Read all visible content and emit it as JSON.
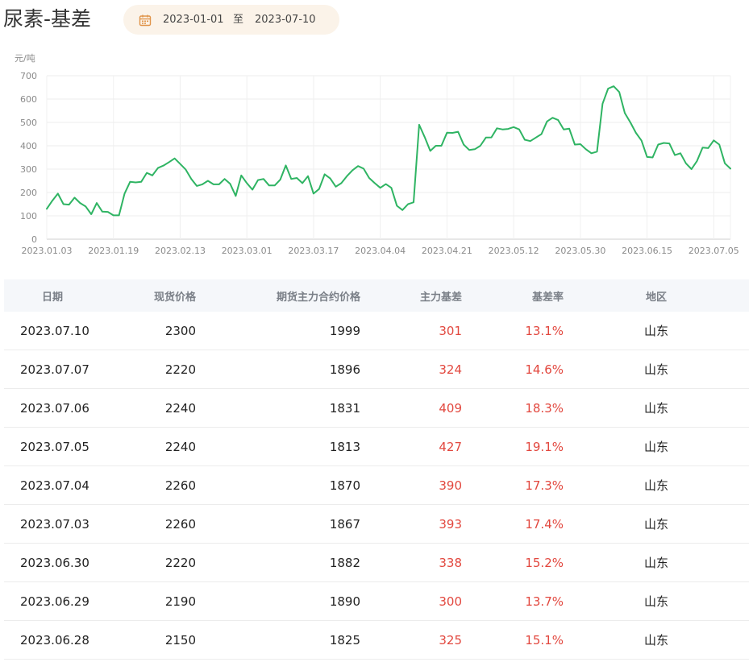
{
  "page": {
    "title": "尿素-基差"
  },
  "date_filter": {
    "start": "2023-01-01",
    "separator": "至",
    "end": "2023-07-10"
  },
  "colors": {
    "line": "#2fb463",
    "accent_red": "#e2473e",
    "header_bg": "#f5f7fa",
    "filter_bg": "#fbf3e9"
  },
  "chart_data": {
    "type": "line",
    "unit_label": "元/吨",
    "ylim": [
      0,
      700
    ],
    "yticks": [
      0,
      100,
      200,
      300,
      400,
      500,
      600,
      700
    ],
    "grid": true,
    "xtick_labels": [
      "2023.01.03",
      "2023.01.19",
      "2023.02.13",
      "2023.03.01",
      "2023.03.17",
      "2023.04.04",
      "2023.04.21",
      "2023.05.12",
      "2023.05.30",
      "2023.06.15",
      "2023.07.05"
    ],
    "xtick_index": [
      0,
      12,
      24,
      36,
      48,
      60,
      72,
      84,
      96,
      108,
      120
    ],
    "series": [
      {
        "values": [
          130,
          165,
          195,
          150,
          148,
          178,
          155,
          140,
          107,
          155,
          118,
          117,
          102,
          102,
          195,
          246,
          243,
          246,
          284,
          273,
          305,
          315,
          330,
          346,
          322,
          298,
          258,
          228,
          235,
          250,
          235,
          235,
          258,
          237,
          185,
          273,
          240,
          212,
          253,
          258,
          230,
          230,
          255,
          316,
          258,
          262,
          240,
          270,
          195,
          215,
          278,
          260,
          225,
          240,
          270,
          295,
          313,
          302,
          262,
          240,
          220,
          236,
          220,
          143,
          125,
          150,
          158,
          490,
          437,
          378,
          400,
          400,
          456,
          455,
          460,
          405,
          382,
          385,
          400,
          435,
          436,
          475,
          470,
          472,
          480,
          470,
          426,
          420,
          435,
          450,
          504,
          520,
          510,
          470,
          473,
          405,
          407,
          385,
          368,
          375,
          580,
          645,
          655,
          630,
          540,
          500,
          455,
          422,
          352,
          350,
          405,
          412,
          410,
          360,
          368,
          325,
          300,
          335,
          392,
          390,
          423,
          405,
          325,
          302
        ]
      }
    ]
  },
  "table": {
    "headers": [
      "日期",
      "现货价格",
      "期货主力合约价格",
      "主力基差",
      "基差率",
      "地区"
    ],
    "rows": [
      [
        "2023.07.10",
        "2300",
        "1999",
        "301",
        "13.1%",
        "山东"
      ],
      [
        "2023.07.07",
        "2220",
        "1896",
        "324",
        "14.6%",
        "山东"
      ],
      [
        "2023.07.06",
        "2240",
        "1831",
        "409",
        "18.3%",
        "山东"
      ],
      [
        "2023.07.05",
        "2240",
        "1813",
        "427",
        "19.1%",
        "山东"
      ],
      [
        "2023.07.04",
        "2260",
        "1870",
        "390",
        "17.3%",
        "山东"
      ],
      [
        "2023.07.03",
        "2260",
        "1867",
        "393",
        "17.4%",
        "山东"
      ],
      [
        "2023.06.30",
        "2220",
        "1882",
        "338",
        "15.2%",
        "山东"
      ],
      [
        "2023.06.29",
        "2190",
        "1890",
        "300",
        "13.7%",
        "山东"
      ],
      [
        "2023.06.28",
        "2150",
        "1825",
        "325",
        "15.1%",
        "山东"
      ]
    ]
  }
}
